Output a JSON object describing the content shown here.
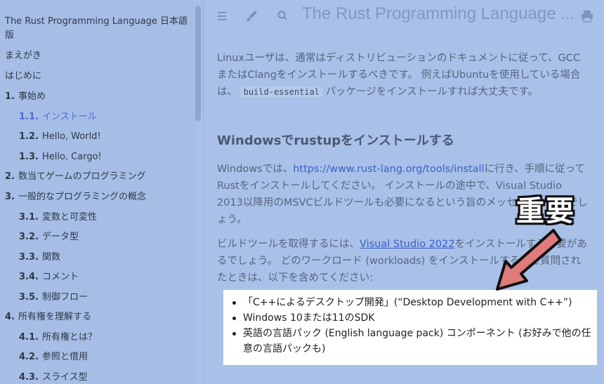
{
  "sidebar": {
    "book_title": "The Rust Programming Language 日本語版",
    "items": [
      {
        "num": "",
        "label": "まえがき",
        "active": false
      },
      {
        "num": "",
        "label": "はじめに",
        "active": false
      },
      {
        "num": "1.",
        "label": "事始め",
        "active": false
      },
      {
        "num": "1.1.",
        "label": "インストール",
        "active": true
      },
      {
        "num": "1.2.",
        "label": "Hello, World!",
        "active": false
      },
      {
        "num": "1.3.",
        "label": "Hello, Cargo!",
        "active": false
      },
      {
        "num": "2.",
        "label": "数当てゲームのプログラミング",
        "active": false
      },
      {
        "num": "3.",
        "label": "一般的なプログラミングの概念",
        "active": false
      },
      {
        "num": "3.1.",
        "label": "変数と可変性",
        "active": false
      },
      {
        "num": "3.2.",
        "label": "データ型",
        "active": false
      },
      {
        "num": "3.3.",
        "label": "関数",
        "active": false
      },
      {
        "num": "3.4.",
        "label": "コメント",
        "active": false
      },
      {
        "num": "3.5.",
        "label": "制御フロー",
        "active": false
      },
      {
        "num": "4.",
        "label": "所有権を理解する",
        "active": false
      },
      {
        "num": "4.1.",
        "label": "所有権とは？",
        "active": false
      },
      {
        "num": "4.2.",
        "label": "参照と借用",
        "active": false
      },
      {
        "num": "4.3.",
        "label": "スライス型",
        "active": false
      }
    ]
  },
  "menubar": {
    "heading": "The Rust Programming Language ...",
    "icons": [
      "menu-icon",
      "brush-icon",
      "search-icon",
      "print-icon"
    ]
  },
  "content": {
    "para1_a": "Linuxユーザは、通常はディストリビューションのドキュメントに従って、GCCまたはClangをインストールするべきです。 例えばUbuntuを使用している場合は、",
    "para1_code": "build-essential",
    "para1_b": "パッケージをインストールすれば大丈夫です。",
    "section_heading": "Windowsでrustupをインストールする",
    "para2_a": "Windowsでは、",
    "para2_link": "https://www.rust-lang.org/tools/install",
    "para2_b": "に行き、手順に従ってRustをインストールしてください。 インストールの途中で、Visual Studio 2013以降用のMSVCビルドツールも必要になるという旨のメッセージが出るでしょう。",
    "para3_a": "ビルドツールを取得するには、",
    "para3_link": "Visual Studio 2022",
    "para3_b": "をインストールする必要があるでしょう。 どのワークロード (workloads) をインストールするかと質問されたときは、以下を含めてください:",
    "bullets": [
      "「C++によるデスクトップ開発」(“Desktop Development with C++”)",
      "Windows 10または11のSDK",
      "英語の言語パック (English language pack) コンポーネント (お好みで他の任意の言語パックも)"
    ]
  },
  "annotation": {
    "label": "重要",
    "arrow_color": "#e07b7b"
  }
}
